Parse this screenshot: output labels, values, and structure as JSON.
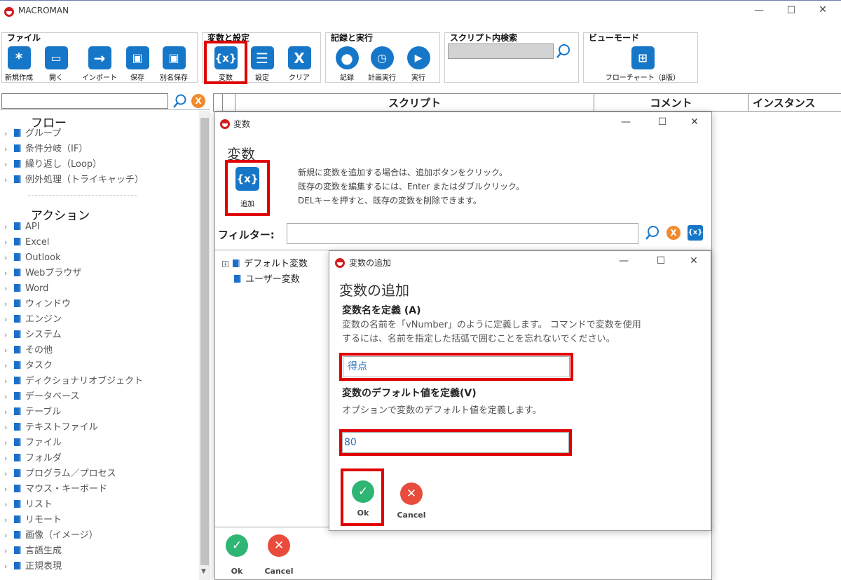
{
  "app": {
    "title": "MACROMAN"
  },
  "ribbon": {
    "file": {
      "title": "ファイル",
      "new": "新規作成",
      "open": "開く",
      "import": "インポート",
      "save": "保存",
      "save_as": "別名保存"
    },
    "vars": {
      "title": "変数と設定",
      "variables": "変数",
      "settings": "設定",
      "clear": "クリア"
    },
    "record": {
      "title": "記録と実行",
      "record": "記録",
      "schedule": "計画実行",
      "run": "実行"
    },
    "search": {
      "title": "スクリプト内検索"
    },
    "view": {
      "title": "ビューモード",
      "flowchart": "フローチャート（β版）"
    }
  },
  "grid": {
    "script": "スクリプト",
    "comment": "コメント",
    "instance": "インスタンス"
  },
  "left": {
    "flow_title": "フロー",
    "flow_items": [
      "グループ",
      "条件分岐（IF）",
      "繰り返し（Loop）",
      "例外処理（トライキャッチ）"
    ],
    "action_title": "アクション",
    "action_items": [
      "API",
      "Excel",
      "Outlook",
      "Webブラウザ",
      "Word",
      "ウィンドウ",
      "エンジン",
      "システム",
      "その他",
      "タスク",
      "ディクショナリオブジェクト",
      "データベース",
      "テーブル",
      "テキストファイル",
      "ファイル",
      "フォルダ",
      "プログラム／プロセス",
      "マウス・キーボード",
      "リスト",
      "リモート",
      "画像（イメージ）",
      "言語生成",
      "正規表現"
    ]
  },
  "var_dialog": {
    "title": "変数",
    "heading": "変数",
    "add_label": "追加",
    "hint1": "新規に変数を追加する場合は、追加ボタンをクリック。",
    "hint2": "既存の変数を編集するには、Enter またはダブルクリック。",
    "hint3": "DELキーを押すと、既存の変数を削除できます。",
    "filter_label": "フィルター:",
    "tree_default": "デフォルト変数",
    "tree_user": "ユーザー変数",
    "ok": "Ok",
    "cancel": "Cancel"
  },
  "add_dialog": {
    "title": "変数の追加",
    "heading": "変数の追加",
    "name_label": "変数名を定義 (A)",
    "name_hint1": "変数の名前を「vNumber」のように定義します。 コマンドで変数を使用",
    "name_hint2": "するには、名前を指定した括弧で囲むことを忘れないでください。",
    "name_value": "得点",
    "default_label": "変数のデフォルト値を定義(V)",
    "default_hint": "オプションで変数のデフォルト値を定義します。",
    "default_value": "80",
    "ok": "Ok",
    "cancel": "Cancel"
  },
  "colors": {
    "accent": "#1677c9",
    "highlight": "#e00000",
    "ok": "#2fb574",
    "cancel": "#e94b3c"
  }
}
